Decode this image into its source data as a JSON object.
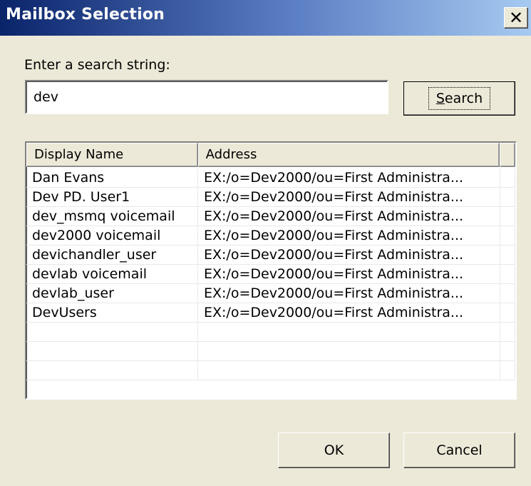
{
  "window": {
    "title": "Mailbox Selection",
    "close_glyph": "✕"
  },
  "search": {
    "prompt": "Enter a search string:",
    "value": "dev",
    "button_mnemonic": "S",
    "button_rest": "earch"
  },
  "list": {
    "columns": [
      "Display Name",
      "Address"
    ],
    "rows": [
      {
        "name": "Dan Evans",
        "address": "EX:/o=Dev2000/ou=First Administra..."
      },
      {
        "name": "Dev PD. User1",
        "address": "EX:/o=Dev2000/ou=First Administra..."
      },
      {
        "name": "dev_msmq voicemail",
        "address": "EX:/o=Dev2000/ou=First Administra..."
      },
      {
        "name": "dev2000 voicemail",
        "address": "EX:/o=Dev2000/ou=First Administra..."
      },
      {
        "name": "devichandler_user",
        "address": "EX:/o=Dev2000/ou=First Administra..."
      },
      {
        "name": "devlab voicemail",
        "address": "EX:/o=Dev2000/ou=First Administra..."
      },
      {
        "name": "devlab_user",
        "address": "EX:/o=Dev2000/ou=First Administra..."
      },
      {
        "name": "DevUsers",
        "address": "EX:/o=Dev2000/ou=First Administra..."
      }
    ]
  },
  "buttons": {
    "ok": "OK",
    "cancel": "Cancel"
  }
}
